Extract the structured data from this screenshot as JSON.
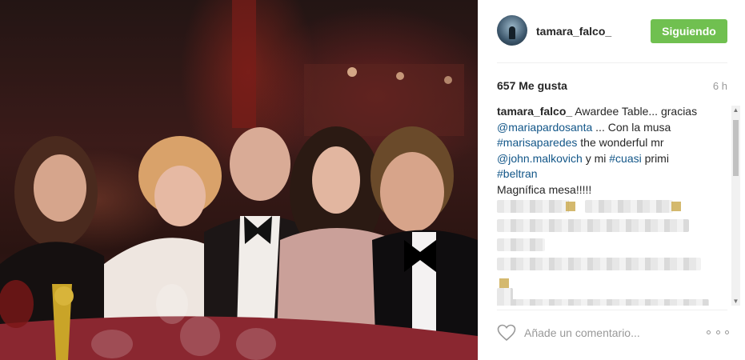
{
  "post": {
    "author": "tamara_falco_",
    "follow_label": "Siguiendo",
    "likes": "657 Me gusta",
    "time": "6 h",
    "caption_text": "Awardee Table... gracias",
    "caption_mention_1": "@mariapardosanta",
    "caption_mid_1": "... Con la musa",
    "caption_hashtag_1": "#marisaparedes",
    "caption_mid_2": "the wonderful mr",
    "caption_mention_2": "@john.malkovich",
    "caption_mid_3": "y mi",
    "caption_hashtag_2": "#cuasi",
    "caption_mid_4": "primi",
    "caption_hashtag_3": "#beltran",
    "caption_end": "Magnífica mesa!!!!!",
    "comment_placeholder": "Añade un comentario...",
    "icons": {
      "like": "heart-icon",
      "more": "ellipsis-icon",
      "scroll_up": "arrow-up-icon",
      "scroll_down": "arrow-down-icon"
    },
    "colors": {
      "follow_button": "#70c050",
      "link": "#125688"
    }
  }
}
